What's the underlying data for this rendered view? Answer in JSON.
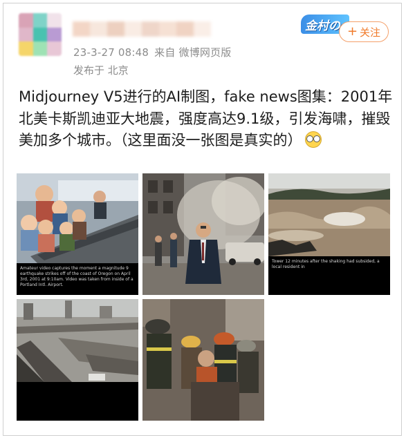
{
  "post": {
    "timestamp": "23-3-27 08:48",
    "source": "来自 微博网页版",
    "location": "发布于 北京",
    "follow_label": "关注",
    "badge_label": "金村の",
    "text": "Midjourney V5进行的AI制图，fake news图集：2001年北美卡斯凯迪亚大地震，强度高达9.1级，引发海啸，摧毁美加多个城市。（这里面没一张图是真实的）",
    "emoji": "glasses-emoji"
  },
  "images": [
    {
      "name": "image-children-airport",
      "caption": "Amateur video captures the moment a magnitude 9 earthquake strikes off of the coast of Oregon on April 3rd, 2001 at 9:10am. Video was taken from inside of a Portland Intl. Airport."
    },
    {
      "name": "image-man-street-dust",
      "caption": ""
    },
    {
      "name": "image-tsunami-shore",
      "caption": "Tower 12 minutes after the shaking had subsided, a local resident in"
    },
    {
      "name": "image-collapsed-highway",
      "caption": ""
    },
    {
      "name": "image-rescue-firefighters",
      "caption": ""
    }
  ],
  "colors": {
    "meta_gray": "#8c8c8c",
    "follow_orange": "#f07a2a",
    "text": "#1c1c1c"
  }
}
